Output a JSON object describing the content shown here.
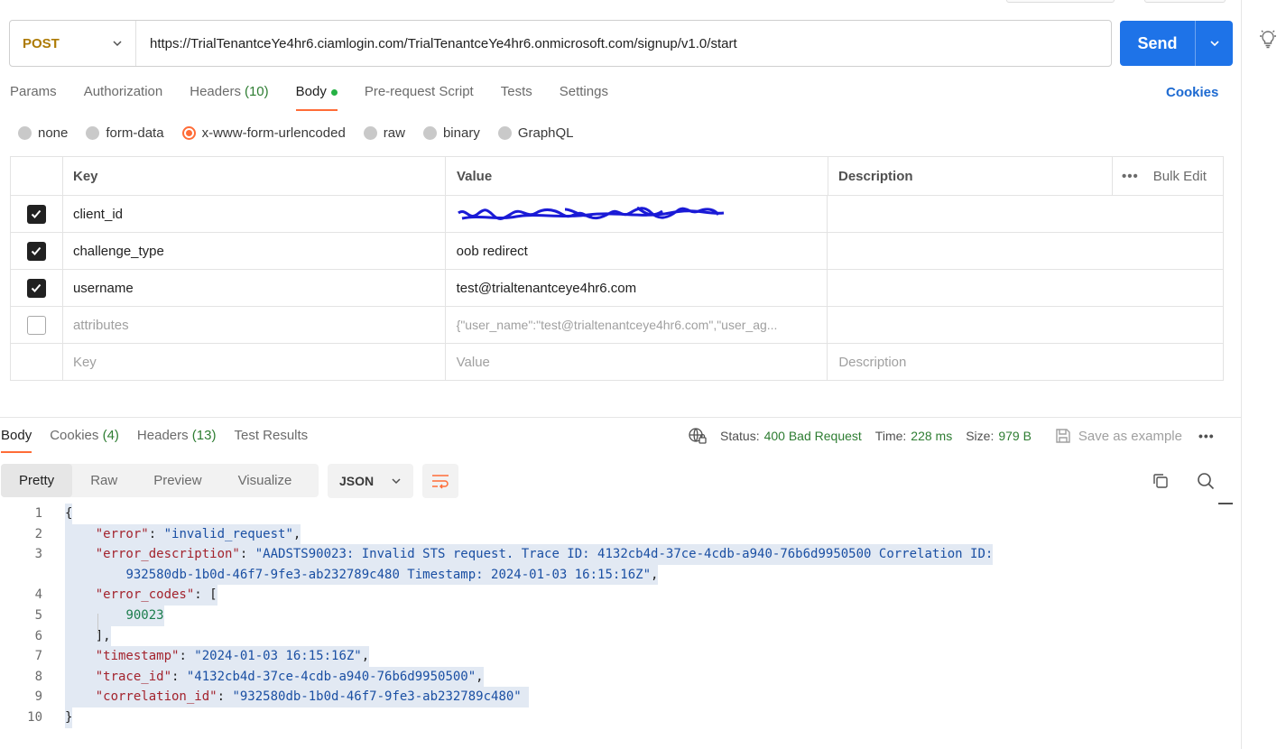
{
  "request": {
    "method": "POST",
    "url": "https://TrialTenantceYe4hr6.ciamlogin.com/TrialTenantceYe4hr6.onmicrosoft.com/signup/v1.0/start",
    "send_label": "Send"
  },
  "request_tabs": {
    "params": "Params",
    "authorization": "Authorization",
    "headers": "Headers",
    "headers_count": "(10)",
    "body": "Body",
    "prerequest": "Pre-request Script",
    "tests": "Tests",
    "settings": "Settings",
    "cookies": "Cookies"
  },
  "body_types": {
    "none": "none",
    "form_data": "form-data",
    "urlencoded": "x-www-form-urlencoded",
    "raw": "raw",
    "binary": "binary",
    "graphql": "GraphQL",
    "selected": "x-www-form-urlencoded"
  },
  "params_table": {
    "headers": {
      "key": "Key",
      "value": "Value",
      "description": "Description",
      "bulk_edit": "Bulk Edit"
    },
    "rows": [
      {
        "checked": true,
        "key": "client_id",
        "value": "",
        "redacted": true
      },
      {
        "checked": true,
        "key": "challenge_type",
        "value": "oob redirect"
      },
      {
        "checked": true,
        "key": "username",
        "value": "test@trialtenantceye4hr6.com"
      },
      {
        "checked": false,
        "key": "attributes",
        "value": "{\"user_name\":\"test@trialtenantceye4hr6.com\",\"user_ag..."
      }
    ],
    "placeholder": {
      "key": "Key",
      "value": "Value",
      "description": "Description"
    }
  },
  "response_tabs": {
    "body": "Body",
    "cookies": "Cookies",
    "cookies_count": "(4)",
    "headers": "Headers",
    "headers_count": "(13)",
    "test_results": "Test Results"
  },
  "response_meta": {
    "status_label": "Status:",
    "status_value": "400 Bad Request",
    "time_label": "Time:",
    "time_value": "228 ms",
    "size_label": "Size:",
    "size_value": "979 B",
    "save_example": "Save as example"
  },
  "view_modes": {
    "pretty": "Pretty",
    "raw": "Raw",
    "preview": "Preview",
    "visualize": "Visualize",
    "format": "JSON"
  },
  "response_lines": {
    "l1": "{",
    "l2_key": "\"error\"",
    "l2_val": "\"invalid_request\"",
    "l3_key": "\"error_description\"",
    "l3_val": "\"AADSTS90023: Invalid STS request. Trace ID: 4132cb4d-37ce-4cdb-a940-76b6d9950500 Correlation ID:",
    "l3b_val": "932580db-1b0d-46f7-9fe3-ab232789c480 Timestamp: 2024-01-03 16:15:16Z\"",
    "l4_key": "\"error_codes\"",
    "l5_val": "90023",
    "l7_key": "\"timestamp\"",
    "l7_val": "\"2024-01-03 16:15:16Z\"",
    "l8_key": "\"trace_id\"",
    "l8_val": "\"4132cb4d-37ce-4cdb-a940-76b6d9950500\"",
    "l9_key": "\"correlation_id\"",
    "l9_val": "\"932580db-1b0d-46f7-9fe3-ab232789c480\"",
    "l10": "}"
  },
  "line_numbers": [
    "1",
    "2",
    "3",
    "4",
    "5",
    "6",
    "7",
    "8",
    "9",
    "10"
  ],
  "colors": {
    "send_button": "#1e73e8",
    "method": "#ad7a03",
    "accent_orange": "#ff6c37",
    "status_green": "#2e7d32",
    "link_blue": "#1d6ad1"
  },
  "icons": [
    "lightbulb-icon",
    "chevron-down-icon",
    "check-icon",
    "globe-icon",
    "save-icon",
    "copy-icon",
    "search-icon",
    "wrap-lines-icon",
    "more-icon"
  ]
}
